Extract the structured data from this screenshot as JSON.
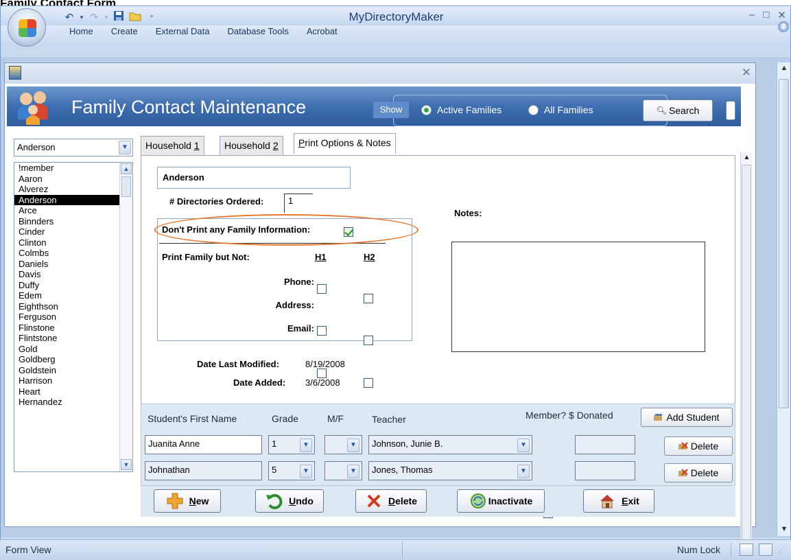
{
  "caption": "Family Contact Form",
  "app": {
    "title": "MyDirectoryMaker"
  },
  "ribbon": {
    "tabs": [
      "Home",
      "Create",
      "External Data",
      "Database Tools",
      "Acrobat"
    ]
  },
  "form": {
    "title": "Family Contact Maintenance",
    "show_label": "Show",
    "radio_active": "Active Families",
    "radio_all": "All Families",
    "selected_radio": "Active Families",
    "search_label": "Search"
  },
  "family_combo": {
    "value": "Anderson"
  },
  "family_list": {
    "items": [
      "!member",
      "Aaron",
      "Alverez",
      "Anderson",
      "Arce",
      "Binnders",
      "Cinder",
      "Clinton",
      "Colmbs",
      "Daniels",
      "Davis",
      "Duffy",
      "Edem",
      "Eighthson",
      "Ferguson",
      "Flinstone",
      "Flintstone",
      "Gold",
      "Goldberg",
      "Goldstein",
      "Harrison",
      "Heart",
      "Hernandez"
    ],
    "selected": "Anderson"
  },
  "tabs": [
    {
      "prefix": "Household ",
      "key": "1",
      "suffix": ""
    },
    {
      "prefix": "Household ",
      "key": "2",
      "suffix": ""
    },
    {
      "prefix": "",
      "key": "P",
      "suffix": "rint Options & Notes"
    }
  ],
  "print_options": {
    "family_name": "Anderson",
    "directories_label": "# Directories Ordered:",
    "directories_value": "1",
    "dont_print_label": "Don't Print any Family Information:",
    "dont_print_checked": true,
    "print_family_label": "Print Family but Not:",
    "h1": "H1",
    "h2": "H2",
    "rows": [
      {
        "label": "Phone:",
        "h1": false,
        "h2": false
      },
      {
        "label": "Address:",
        "h1": false,
        "h2": false
      },
      {
        "label": "Email:",
        "h1": false,
        "h2": false
      }
    ],
    "notes_label": "Notes:",
    "notes_value": "",
    "date_modified_label": "Date Last Modified:",
    "date_modified": "8/19/2008",
    "date_added_label": "Date Added:",
    "date_added": "3/6/2008"
  },
  "students": {
    "headers": [
      "Student's First Name",
      "Grade",
      "M/F",
      "Teacher",
      "Member? $ Donated"
    ],
    "add_label": "Add Student",
    "delete_label": "Delete",
    "rows": [
      {
        "name": "Juanita Anne",
        "grade": "1",
        "mf": "",
        "teacher": "Johnson, Junie B.",
        "member": false,
        "donated": ""
      },
      {
        "name": "Johnathan",
        "grade": "5",
        "mf": "",
        "teacher": "Jones, Thomas",
        "member": false,
        "donated": ""
      }
    ]
  },
  "buttons": [
    {
      "key": "N",
      "rest": "ew"
    },
    {
      "key": "U",
      "rest": "ndo"
    },
    {
      "key": "D",
      "rest": "elete"
    },
    {
      "key": "",
      "rest": "Inactivate"
    },
    {
      "key": "E",
      "pre": "",
      "rest": "xit"
    }
  ],
  "status": {
    "left": "Form View",
    "numlock": "Num Lock"
  },
  "colors": {
    "accent": "#3e6eb0",
    "highlight_oval": "#e8772e"
  }
}
